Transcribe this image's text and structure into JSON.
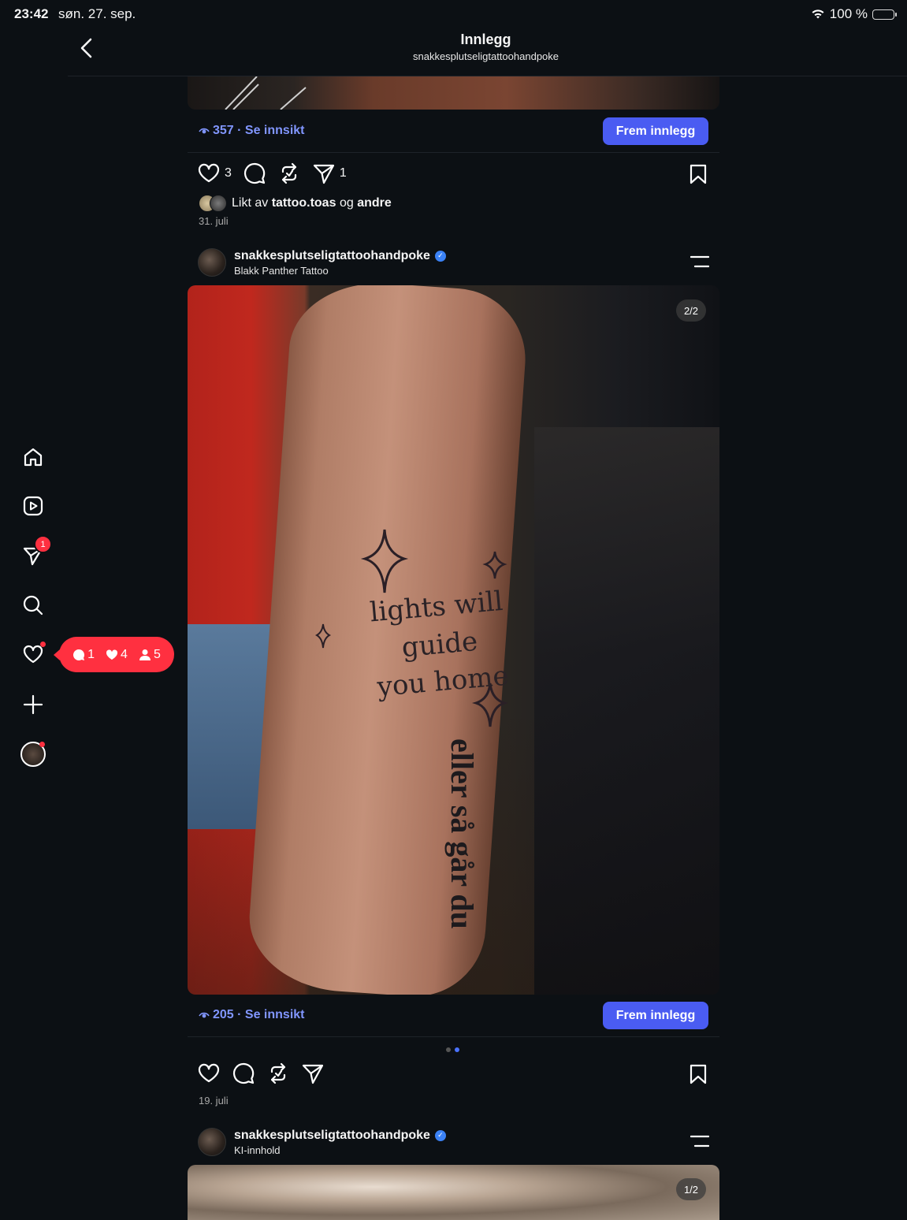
{
  "status": {
    "time": "23:42",
    "date": "søn. 27. sep.",
    "battery": "100 %"
  },
  "header": {
    "title": "Innlegg",
    "subtitle": "snakkesplutseligtattoohandpoke"
  },
  "sidebar": {
    "items": [
      {
        "name": "home",
        "icon": "home-icon"
      },
      {
        "name": "reels",
        "icon": "reels-icon"
      },
      {
        "name": "messages",
        "icon": "send-icon",
        "badge": "1"
      },
      {
        "name": "search",
        "icon": "search-icon"
      },
      {
        "name": "activity",
        "icon": "heart-icon"
      },
      {
        "name": "create",
        "icon": "plus-icon"
      },
      {
        "name": "profile",
        "icon": "avatar"
      }
    ],
    "notifications": {
      "comments": "1",
      "likes": "4",
      "follows": "5"
    }
  },
  "posts": [
    {
      "views": "357 · Se innsikt",
      "promote": "Frem innlegg",
      "likes_count": "3",
      "shares_count": "1",
      "liked_by_prefix": "Likt av",
      "liked_by_user": "tattoo.toas",
      "liked_by_mid": "og",
      "liked_by_suffix": "andre",
      "date": "31. juli"
    },
    {
      "username": "snakkesplutseligtattoohandpoke",
      "location": "Blakk Panther Tattoo",
      "counter": "2/2",
      "tattoo_line1": "lights will guide",
      "tattoo_line2": "you home",
      "tattoo_vertical": "eller så går du",
      "views": "205 · Se innsikt",
      "promote": "Frem innlegg",
      "carousel_index": 2,
      "carousel_total": 2,
      "date": "19. juli"
    },
    {
      "username": "snakkesplutseligtattoohandpoke",
      "location": "KI-innhold",
      "counter": "1/2"
    }
  ],
  "colors": {
    "background": "#0c1014",
    "accent": "#4a5cf2",
    "link": "#8196ff",
    "notification": "#ff3040"
  }
}
